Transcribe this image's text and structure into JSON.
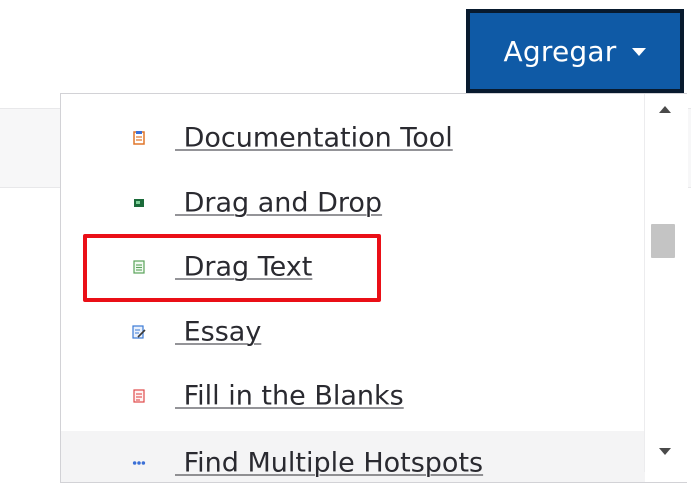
{
  "toolbar": {
    "add_button_label": "Agregar"
  },
  "menu": {
    "items": [
      {
        "label": " Documentation Tool",
        "icon": "document-tool-icon",
        "icon_color": "#e0762a"
      },
      {
        "label": " Drag and Drop",
        "icon": "drag-drop-icon",
        "icon_color": "#1b6b3a"
      },
      {
        "label": " Drag Text",
        "icon": "drag-text-icon",
        "icon_color": "#5aa35a",
        "highlighted": true
      },
      {
        "label": " Essay",
        "icon": "essay-icon",
        "icon_color": "#3a7ad6"
      },
      {
        "label": " Fill in the Blanks",
        "icon": "fill-blanks-icon",
        "icon_color": "#e04a4a"
      },
      {
        "label": " Find Multiple Hotspots",
        "icon": "hotspots-icon",
        "icon_color": "#3a6fd6"
      }
    ]
  },
  "colors": {
    "accent": "#0f5aa6",
    "highlight_border": "#ea0f17"
  }
}
